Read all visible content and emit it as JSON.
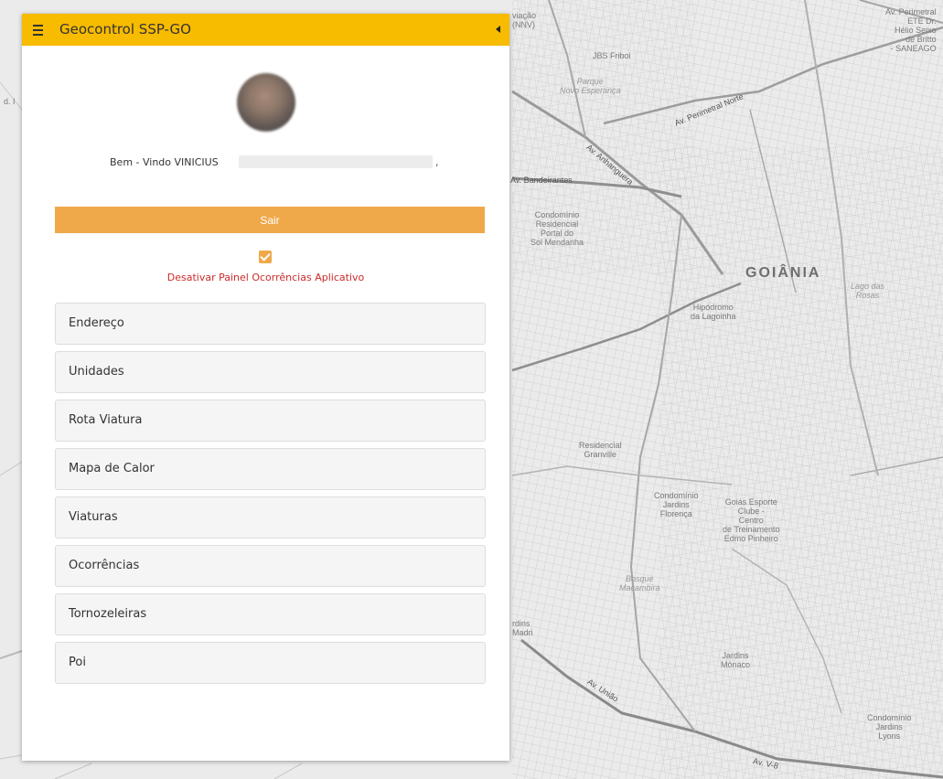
{
  "app": {
    "title": "Geocontrol SSP-GO"
  },
  "user": {
    "welcome": "Bem - Vindo VINICIUS",
    "comma": ","
  },
  "actions": {
    "logout_label": "Sair"
  },
  "settings": {
    "disable_panel_label": "Desativar Painel Ocorrências Aplicativo",
    "disable_panel_checked": true
  },
  "menu": {
    "items": [
      {
        "label": "Endereço"
      },
      {
        "label": "Unidades"
      },
      {
        "label": "Rota Viatura"
      },
      {
        "label": "Mapa de Calor"
      },
      {
        "label": "Viaturas"
      },
      {
        "label": "Ocorrências"
      },
      {
        "label": "Tornozeleiras"
      },
      {
        "label": "Poi"
      }
    ]
  },
  "map": {
    "city": "GOIÂNIA",
    "labels": {
      "aviacao": "viação\n(NNV)",
      "jbs": "JBS Friboi",
      "parque": "Parque\nNovo Esperança",
      "perimetral": "Av. Perimetral Norte",
      "anhanguera": "Av. Anhanguera",
      "bandeirantes": "Av. Bandeirantes",
      "condominio_portal": "Condomínio\nResidencial\nPortal do\nSol Mendanha",
      "hipodromo": "Hipódromo\nda Lagoinha",
      "lago": "Lago das\nRosas",
      "granville": "Residencial\nGranville",
      "jardins_florenca": "Condomínio\nJardins\nFlorença",
      "goias_esporte": "Goiás Esporte\nClube -\nCentro\nde Treinamento\nEdmo Pinheiro",
      "bosque": "Bosque\nMacambira",
      "jardins_madri": "rdins\nMadri",
      "jardins_monaco": "Jardins\nMônaco",
      "av_uniao": "Av. União",
      "av_v8": "Av. V-8",
      "condominio_lyons": "Condomínio\nJardins\nLyons",
      "ete": "Av. Perimetral\nETE Dr.\nHélio Seixo\nde Britto\n- SANEAGO",
      "left_edge": "d. I"
    }
  },
  "colors": {
    "header": "#f7bb00",
    "accent": "#efa94a",
    "warning_text": "#cc2a2a"
  },
  "icons": {
    "menu": "hamburger-icon",
    "collapse": "caret-left-icon"
  }
}
